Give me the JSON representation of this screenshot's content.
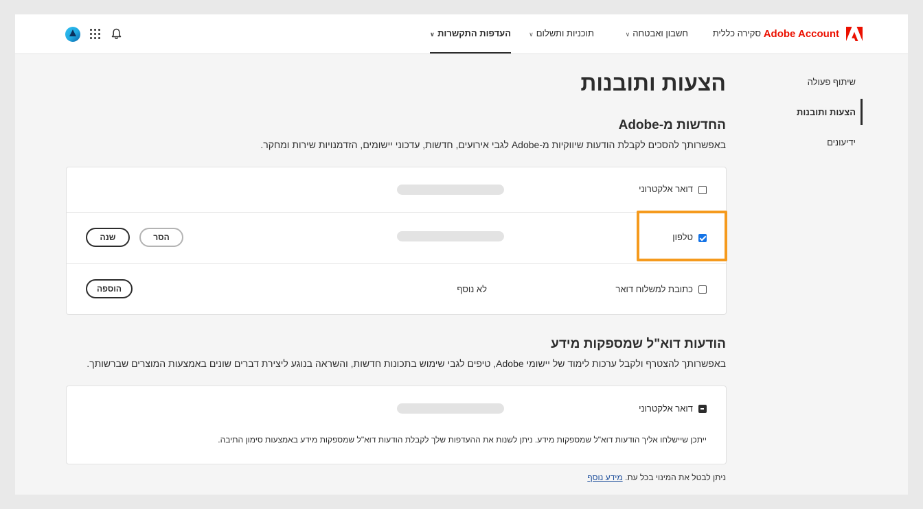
{
  "header": {
    "brand": "Adobe Account",
    "nav": [
      {
        "label": "סקירה כללית"
      },
      {
        "label": "חשבון ואבטחה"
      },
      {
        "label": "תוכניות ותשלום"
      },
      {
        "label": "העדפות התקשרות"
      }
    ],
    "icons": [
      "adobe-logo-icon",
      "bell-icon",
      "apps-grid-icon",
      "avatar"
    ],
    "colors": {
      "brand": "#eb1000",
      "highlight": "#f59a1d",
      "checkbox": "#1473e6"
    }
  },
  "sidebar": {
    "items": [
      {
        "label": "שיתוף פעולה"
      },
      {
        "label": "הצעות ותובנות"
      },
      {
        "label": "ידיעונים"
      }
    ],
    "active": "הצעות ותובנות"
  },
  "page": {
    "title": "הצעות ותובנות",
    "news": {
      "heading": "החדשות מ-Adobe",
      "description": "באפשרותך להסכים לקבלת הודעות שיווקיות מ-Adobe לגבי אירועים, חדשות, עדכוני יישומים, הזדמנויות שירות ומחקר.",
      "rows": [
        {
          "label": "דואר אלקטרוני",
          "checked": false
        },
        {
          "label": "טלפון",
          "checked": true,
          "remove_label": "הסר",
          "change_label": "שנה"
        },
        {
          "label": "כתובת למשלוח דואר",
          "checked": false,
          "value": "לא נוסף",
          "add_label": "הוספה"
        }
      ]
    },
    "informative": {
      "heading": "הודעות דוא\"ל שמספקות מידע",
      "description": "באפשרותך להצטרף ולקבל ערכות לימוד של יישומי Adobe, טיפים לגבי שימוש בתכונות חדשות, והשראה בנוגע ליצירת דברים שונים באמצעות המוצרים שברשותך.",
      "row_label": "דואר אלקטרוני",
      "note": "ייתכן שיישלחו אליך הודעות דוא\"ל שמספקות מידע. ניתן לשנות את ההעדפות שלך לקבלת הודעות דוא\"ל שמספקות מידע באמצעות סימון התיבה."
    },
    "footer": {
      "text": "ניתן לבטל את המינוי בכל עת.",
      "link": "מידע נוסף"
    }
  }
}
